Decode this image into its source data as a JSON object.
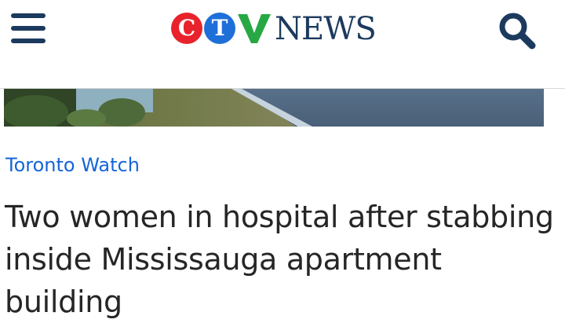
{
  "header": {
    "menu_icon": "hamburger-menu-icon",
    "logo": {
      "letters": [
        "C",
        "T",
        "V"
      ],
      "wordmark": "NEWS",
      "colors": {
        "c": "#e8232b",
        "t": "#1e6fd8",
        "v": "#27a844",
        "wordmark": "#1c3a5e"
      }
    },
    "search_icon": "search-icon"
  },
  "hero_image": {
    "description_icon": "article-photo"
  },
  "article": {
    "category": "Toronto Watch",
    "headline": "Two women in hospital after stabbing inside Mississauga apartment building"
  },
  "colors": {
    "brand_navy": "#1c3a5e",
    "link_blue": "#1565d8",
    "headline_text": "#262626"
  }
}
